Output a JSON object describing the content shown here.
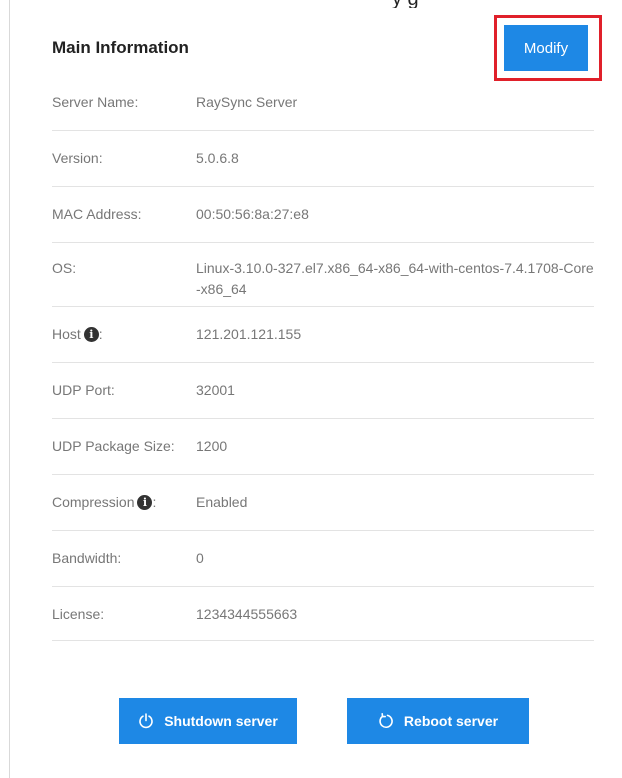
{
  "header": {
    "clipped_text": "y g"
  },
  "panel": {
    "title": "Main Information",
    "modify_label": "Modify"
  },
  "info": {
    "rows": [
      {
        "label": "Server Name:",
        "value": "RaySync Server"
      },
      {
        "label": "Version:",
        "value": "5.0.6.8"
      },
      {
        "label": "MAC Address:",
        "value": "00:50:56:8a:27:e8"
      },
      {
        "label": "OS:",
        "value": "Linux-3.10.0-327.el7.x86_64-x86_64-with-centos-7.4.1708-Core-x86_64"
      },
      {
        "label": "Host",
        "value": "121.201.121.155"
      },
      {
        "label": "UDP Port:",
        "value": "32001"
      },
      {
        "label": "UDP Package Size:",
        "value": "1200"
      },
      {
        "label": "Compression",
        "value": "Enabled"
      },
      {
        "label": "Bandwidth:",
        "value": "0"
      },
      {
        "label": "License:",
        "value": "1234344555663"
      }
    ],
    "label_suffix": ":",
    "info_glyph": "i"
  },
  "actions": {
    "shutdown_label": "Shutdown server",
    "reboot_label": "Reboot server",
    "shutdown_icon": "power-icon",
    "reboot_icon": "refresh-icon"
  }
}
